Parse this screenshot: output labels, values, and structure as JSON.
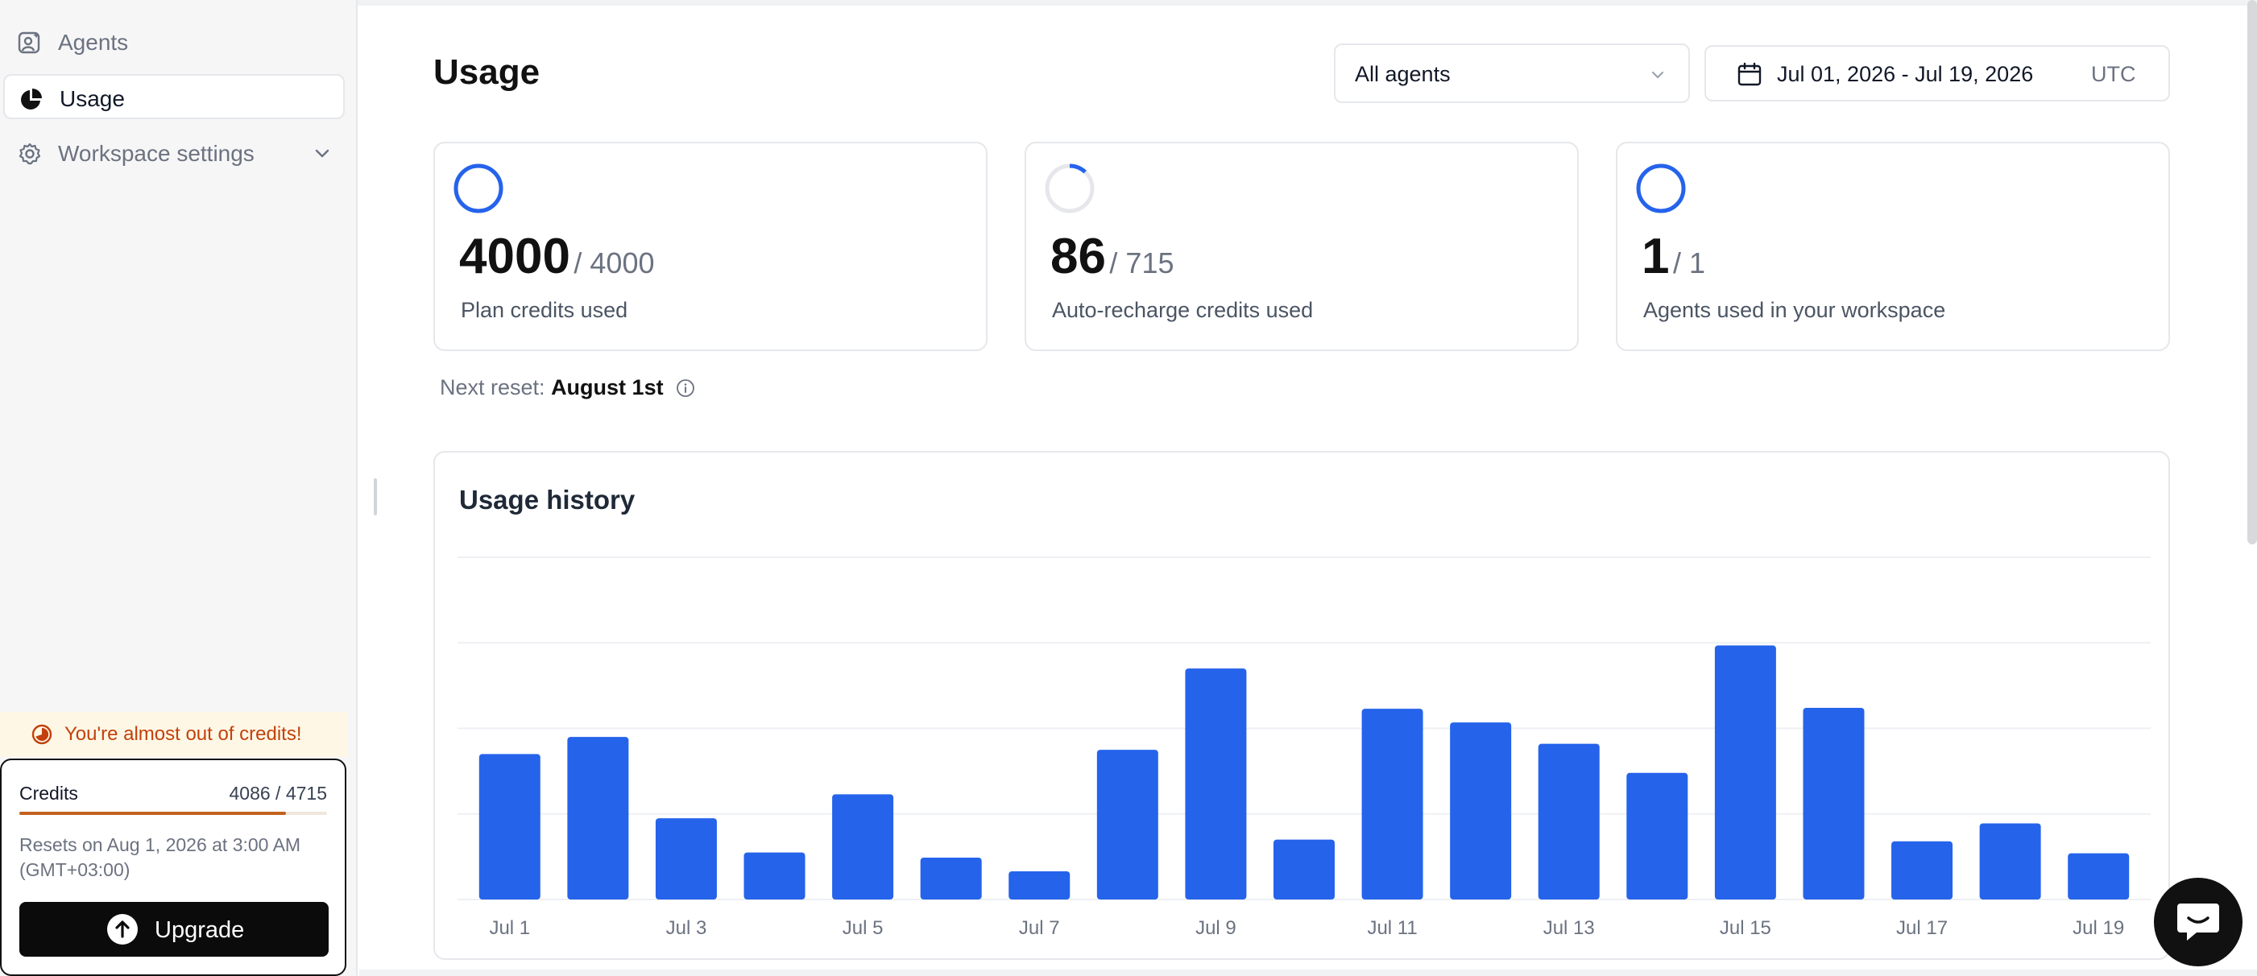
{
  "sidebar": {
    "items": [
      {
        "label": "Agents",
        "icon": "agents-icon"
      },
      {
        "label": "Usage",
        "icon": "pie-chart-icon",
        "active": true
      },
      {
        "label": "Workspace settings",
        "icon": "gear-icon",
        "expandable": true
      }
    ],
    "warning": "You're almost out of credits!",
    "credits": {
      "title": "Credits",
      "value": "4086 / 4715",
      "fraction_used": 0.867,
      "reset_text": "Resets on Aug 1, 2026 at 3:00 AM (GMT+03:00)",
      "upgrade_label": "Upgrade"
    }
  },
  "header": {
    "title": "Usage",
    "agent_filter": "All agents",
    "date_range": "Jul 01, 2026 - Jul 19, 2026",
    "timezone": "UTC"
  },
  "stats": [
    {
      "value": "4000",
      "total": "/ 4000",
      "label": "Plan credits used",
      "fraction": 1.0
    },
    {
      "value": "86",
      "total": "/ 715",
      "label": "Auto-recharge credits used",
      "fraction": 0.12
    },
    {
      "value": "1",
      "total": "/ 1",
      "label": "Agents used in your workspace",
      "fraction": 1.0
    }
  ],
  "next_reset": {
    "label": "Next reset:",
    "date": "August 1st"
  },
  "history": {
    "title": "Usage history"
  },
  "chart_data": {
    "type": "bar",
    "title": "Usage history",
    "categories": [
      "Jul 1",
      "Jul 2",
      "Jul 3",
      "Jul 4",
      "Jul 5",
      "Jul 6",
      "Jul 7",
      "Jul 8",
      "Jul 9",
      "Jul 10",
      "Jul 11",
      "Jul 12",
      "Jul 13",
      "Jul 14",
      "Jul 15",
      "Jul 16",
      "Jul 17",
      "Jul 18",
      "Jul 19"
    ],
    "tick_labels": [
      "Jul 1",
      "Jul 3",
      "Jul 5",
      "Jul 7",
      "Jul 9",
      "Jul 11",
      "Jul 13",
      "Jul 15",
      "Jul 17",
      "Jul 19"
    ],
    "values": [
      170,
      190,
      95,
      55,
      123,
      49,
      33,
      175,
      270,
      70,
      223,
      207,
      182,
      148,
      297,
      224,
      68,
      89,
      54
    ],
    "ylim": [
      0,
      400
    ],
    "grid": true,
    "color": "#2563eb"
  },
  "colors": {
    "accent": "#2563eb",
    "warning": "#c2410c",
    "warning_bg": "#fff7e6"
  }
}
